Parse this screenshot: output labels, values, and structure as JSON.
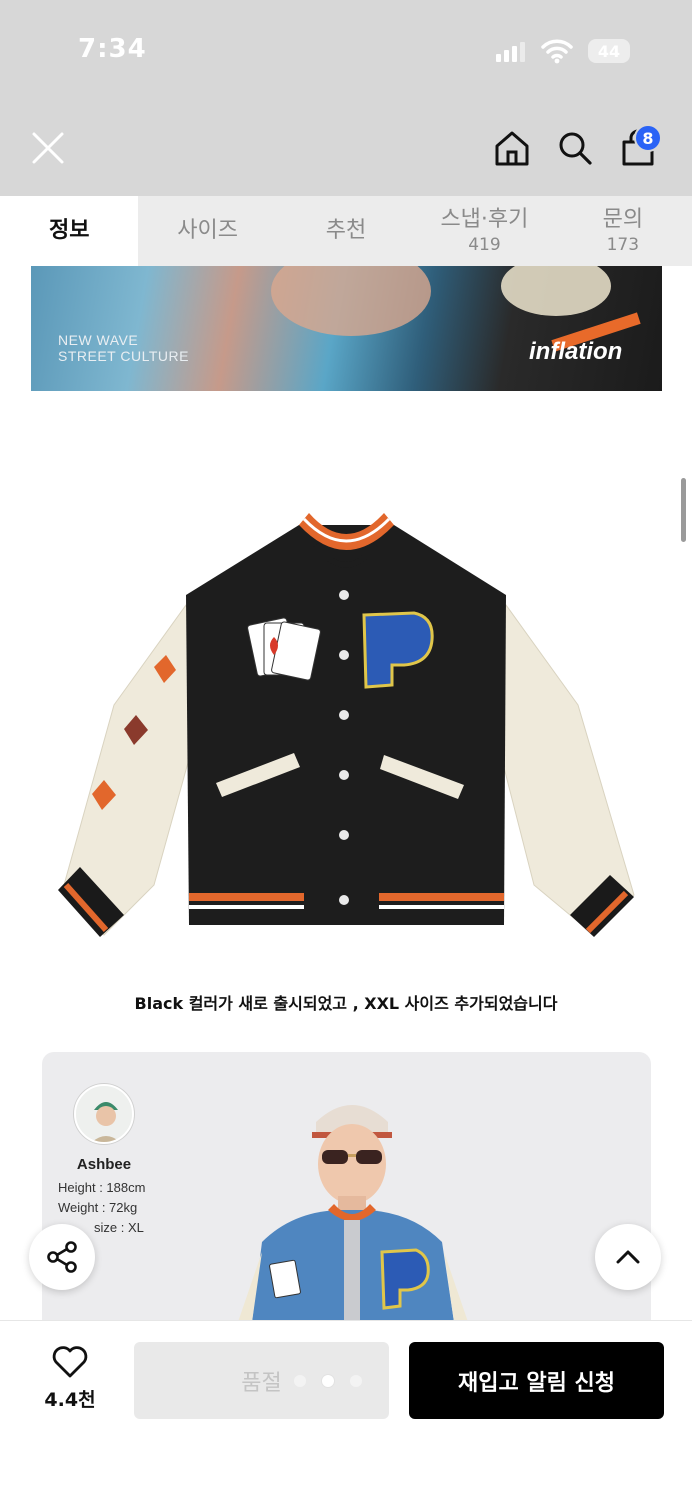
{
  "status_bar": {
    "time": "7:34",
    "battery": "44"
  },
  "header": {
    "cart_count": "8"
  },
  "tabs": [
    {
      "label": "정보",
      "count": ""
    },
    {
      "label": "사이즈",
      "count": ""
    },
    {
      "label": "추천",
      "count": ""
    },
    {
      "label": "스냅·후기",
      "count": "419"
    },
    {
      "label": "문의",
      "count": "173"
    }
  ],
  "banner": {
    "line1": "NEW WAVE",
    "line2": "STREET CULTURE",
    "brand": "inflation"
  },
  "product": {
    "caption": "Black 컬러가 새로 출시되었고 , XXL 사이즈 추가되었습니다"
  },
  "model": {
    "name": "Ashbee",
    "height": "Height : 188cm",
    "weight": "Weight : 72kg",
    "size": "size : XL"
  },
  "bottom_bar": {
    "like_count": "4.4천",
    "soldout_label": "품절",
    "restock_label": "재입고 알림 신청"
  },
  "colors": {
    "accent_badge": "#2a63f6",
    "cta": "#000000",
    "jacket_trim": "#e2672c"
  }
}
